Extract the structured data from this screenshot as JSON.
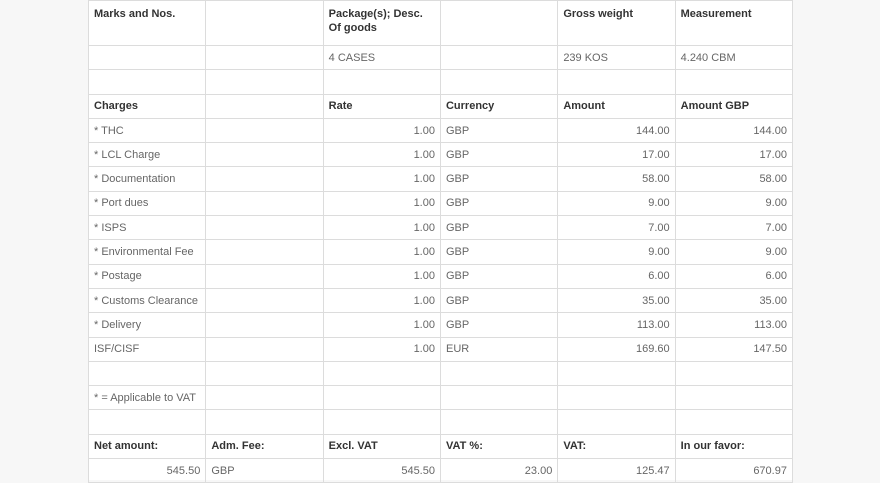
{
  "header": {
    "marks": "Marks and Nos.",
    "packages": "Package(s); Desc. Of goods",
    "gross_weight": "Gross weight",
    "measurement": "Measurement"
  },
  "goods": {
    "packages": "4 CASES",
    "gross_weight": "239 KOS",
    "measurement": "4.240 CBM"
  },
  "charges_header": {
    "charges": "Charges",
    "rate": "Rate",
    "currency": "Currency",
    "amount": "Amount",
    "amount_gbp": "Amount GBP"
  },
  "charges": [
    {
      "name": "* THC",
      "rate": "1.00",
      "currency": "GBP",
      "amount": "144.00",
      "amount_gbp": "144.00"
    },
    {
      "name": "* LCL Charge",
      "rate": "1.00",
      "currency": "GBP",
      "amount": "17.00",
      "amount_gbp": "17.00"
    },
    {
      "name": "* Documentation",
      "rate": "1.00",
      "currency": "GBP",
      "amount": "58.00",
      "amount_gbp": "58.00"
    },
    {
      "name": "* Port dues",
      "rate": "1.00",
      "currency": "GBP",
      "amount": "9.00",
      "amount_gbp": "9.00"
    },
    {
      "name": "* ISPS",
      "rate": "1.00",
      "currency": "GBP",
      "amount": "7.00",
      "amount_gbp": "7.00"
    },
    {
      "name": "* Environmental Fee",
      "rate": "1.00",
      "currency": "GBP",
      "amount": "9.00",
      "amount_gbp": "9.00"
    },
    {
      "name": "* Postage",
      "rate": "1.00",
      "currency": "GBP",
      "amount": "6.00",
      "amount_gbp": "6.00"
    },
    {
      "name": "* Customs Clearance",
      "rate": "1.00",
      "currency": "GBP",
      "amount": "35.00",
      "amount_gbp": "35.00"
    },
    {
      "name": "* Delivery",
      "rate": "1.00",
      "currency": "GBP",
      "amount": "113.00",
      "amount_gbp": "113.00"
    },
    {
      "name": "ISF/CISF",
      "rate": "1.00",
      "currency": "EUR",
      "amount": "169.60",
      "amount_gbp": "147.50"
    }
  ],
  "vat_note": "* = Applicable to VAT",
  "totals_header": {
    "net_amount": "Net amount:",
    "adm_fee": "Adm. Fee:",
    "excl_vat": "Excl. VAT",
    "vat_pct": "VAT %:",
    "vat": "VAT:",
    "in_our_favor": "In our favor:"
  },
  "totals": {
    "net_amount": "545.50",
    "adm_fee": "GBP",
    "excl_vat": "545.50",
    "vat_pct": "23.00",
    "vat": "125.47",
    "in_our_favor": "670.97"
  }
}
